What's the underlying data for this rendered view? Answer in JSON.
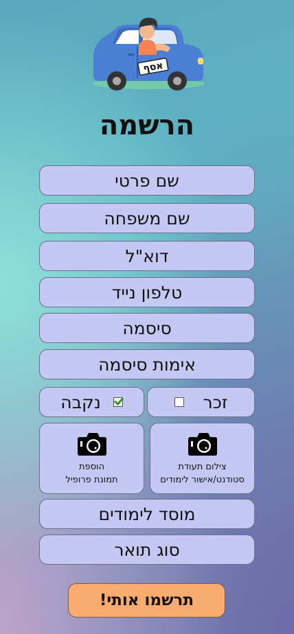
{
  "logo": {
    "plate_text": "אסף"
  },
  "page_title": "הרשמה",
  "fields": {
    "first_name": "שם פרטי",
    "last_name": "שם משפחה",
    "email": "דוא\"ל",
    "phone": "טלפון נייד",
    "password": "סיסמה",
    "password_confirm": "אימות סיסמה",
    "institution": "מוסד לימודים",
    "degree_type": "סוג תואר"
  },
  "gender": {
    "male_label": "זכר",
    "male_checked": false,
    "female_label": "נקבה",
    "female_checked": true
  },
  "photos": {
    "student_id_line1": "צילום תעודת",
    "student_id_line2": "סטודנט/אישור לימודים",
    "profile_line1": "הוספת",
    "profile_line2": "תמונת פרופיל"
  },
  "submit_label": "תרשמו אותי!",
  "colors": {
    "field_bg": "#c4c8f2",
    "submit_bg": "#f9ab70",
    "car_body": "#4a7fd4",
    "check_green": "#2b9a1a"
  }
}
